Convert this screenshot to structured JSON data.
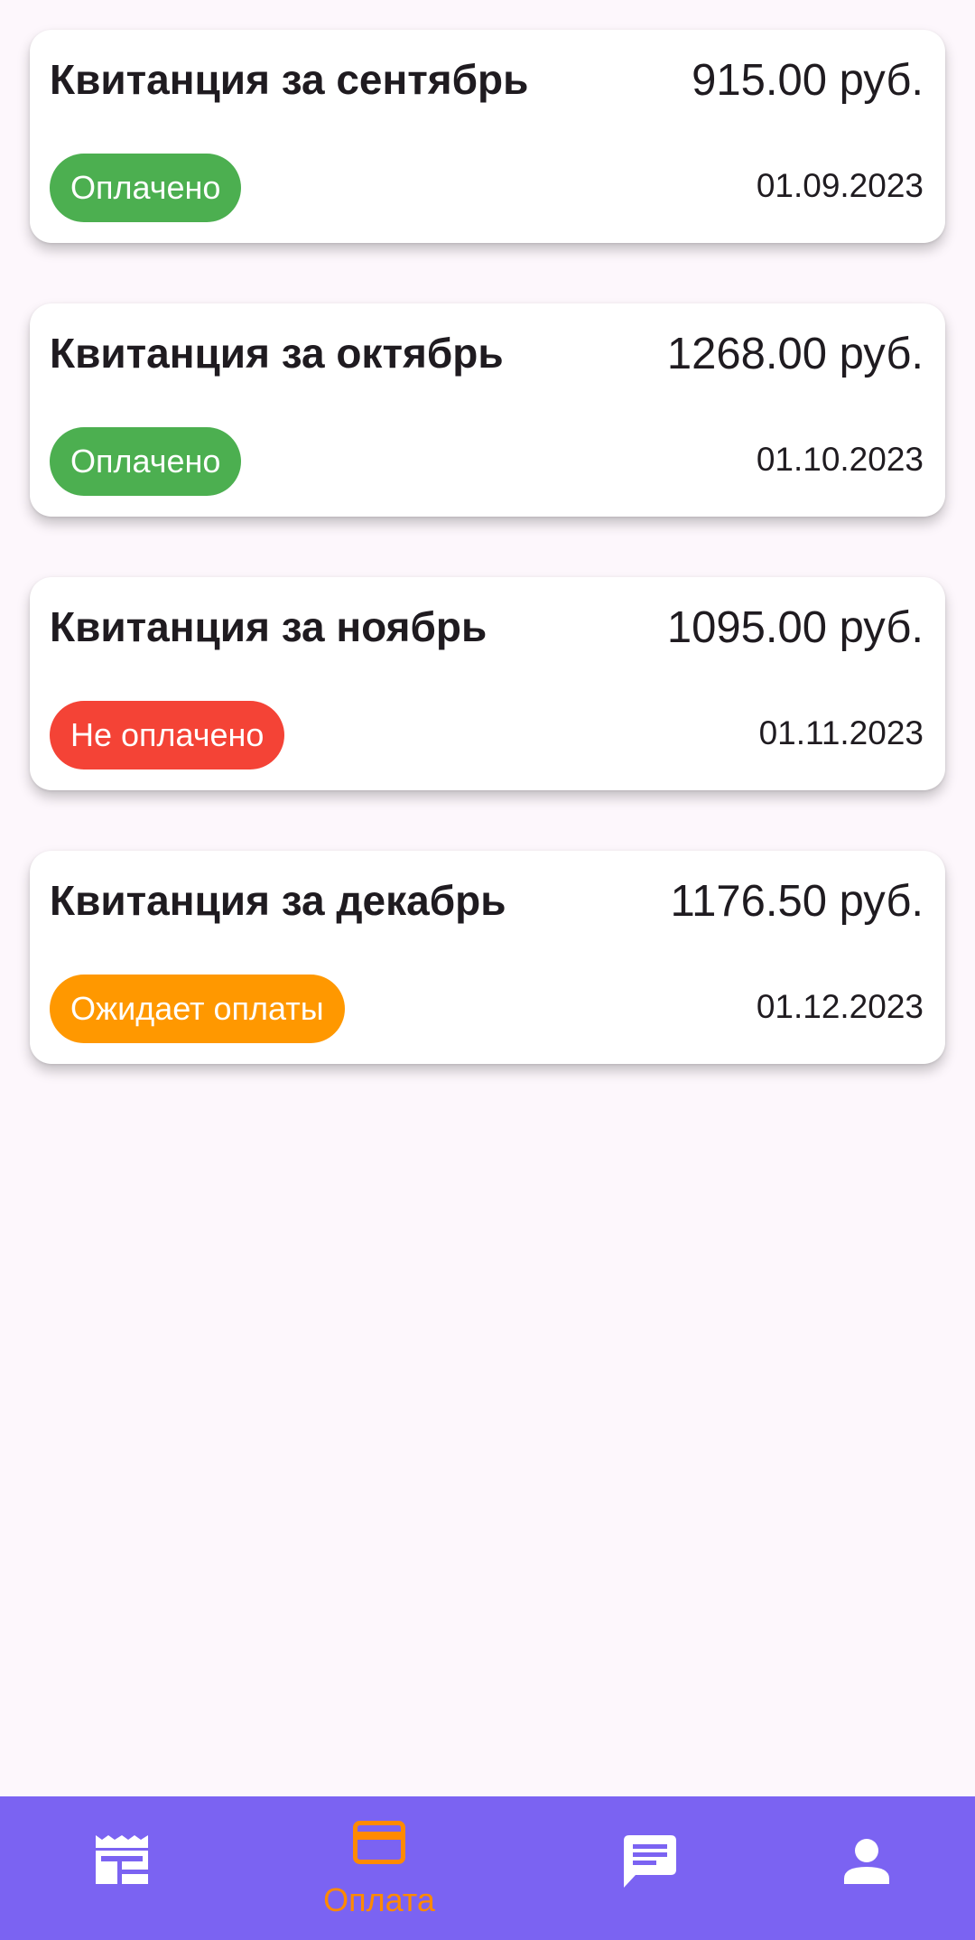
{
  "invoices": [
    {
      "title": "Квитанция за сентябрь",
      "amount": "915.00 руб.",
      "status": "Оплачено",
      "status_color": "#4caf50",
      "date": "01.09.2023"
    },
    {
      "title": "Квитанция за октябрь",
      "amount": "1268.00 руб.",
      "status": "Оплачено",
      "status_color": "#4caf50",
      "date": "01.10.2023"
    },
    {
      "title": "Квитанция за ноябрь",
      "amount": "1095.00 руб.",
      "status": "Не оплачено",
      "status_color": "#f44336",
      "date": "01.11.2023"
    },
    {
      "title": "Квитанция за декабрь",
      "amount": "1176.50 руб.",
      "status": "Ожидает оплаты",
      "status_color": "#ff9800",
      "date": "01.12.2023"
    }
  ],
  "nav": {
    "background": "#7b63f2",
    "active_color": "#ff8a00",
    "items": [
      {
        "icon": "receipt-icon",
        "label": ""
      },
      {
        "icon": "credit-card-icon",
        "label": "Оплата",
        "active": true
      },
      {
        "icon": "chat-icon",
        "label": ""
      },
      {
        "icon": "person-icon",
        "label": ""
      }
    ]
  }
}
